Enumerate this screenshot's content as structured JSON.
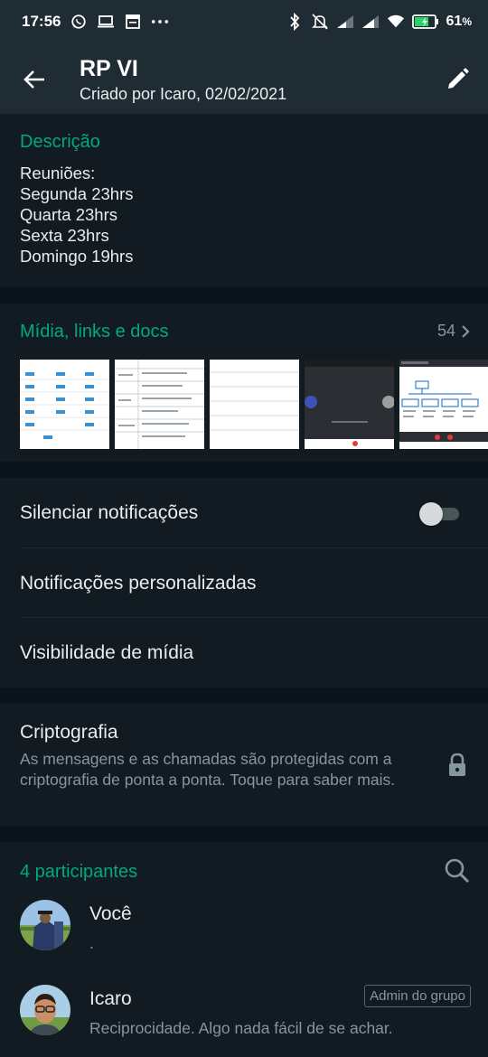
{
  "status_bar": {
    "time": "17:56",
    "left_icons": [
      "whatsapp-icon",
      "laptop-icon",
      "calendar-icon",
      "more-icon"
    ],
    "right_icons": [
      "bluetooth-icon",
      "alarm-off-icon",
      "signal-icon",
      "signal-icon",
      "wifi-icon",
      "battery-icon"
    ],
    "battery": "61",
    "battery_unit": "%"
  },
  "header": {
    "title": "RP VI",
    "subtitle": "Criado por Icaro, 02/02/2021"
  },
  "description": {
    "title": "Descrição",
    "lines": [
      "Reuniões:",
      "Segunda 23hrs",
      "Quarta 23hrs",
      "Sexta 23hrs",
      "Domingo 19hrs"
    ]
  },
  "media": {
    "title": "Mídia, links e docs",
    "count": "54"
  },
  "notifications": {
    "mute_label": "Silenciar notificações",
    "mute_on": false,
    "custom_label": "Notificações personalizadas",
    "visibility_label": "Visibilidade de mídia"
  },
  "crypto": {
    "title": "Criptografia",
    "body": "As mensagens e as chamadas são protegidas com a criptografia de ponta a ponta. Toque para saber mais."
  },
  "participants": {
    "title": "4 participantes",
    "items": [
      {
        "name": "Você",
        "status": ".",
        "badge": ""
      },
      {
        "name": "Icaro",
        "status": "Reciprocidade. Algo nada fácil de se achar.",
        "badge": "Admin do grupo"
      }
    ]
  },
  "colors": {
    "accent": "#00a884",
    "bar": "#1f2c33",
    "panel": "#111b21",
    "gap": "#0b141a"
  }
}
